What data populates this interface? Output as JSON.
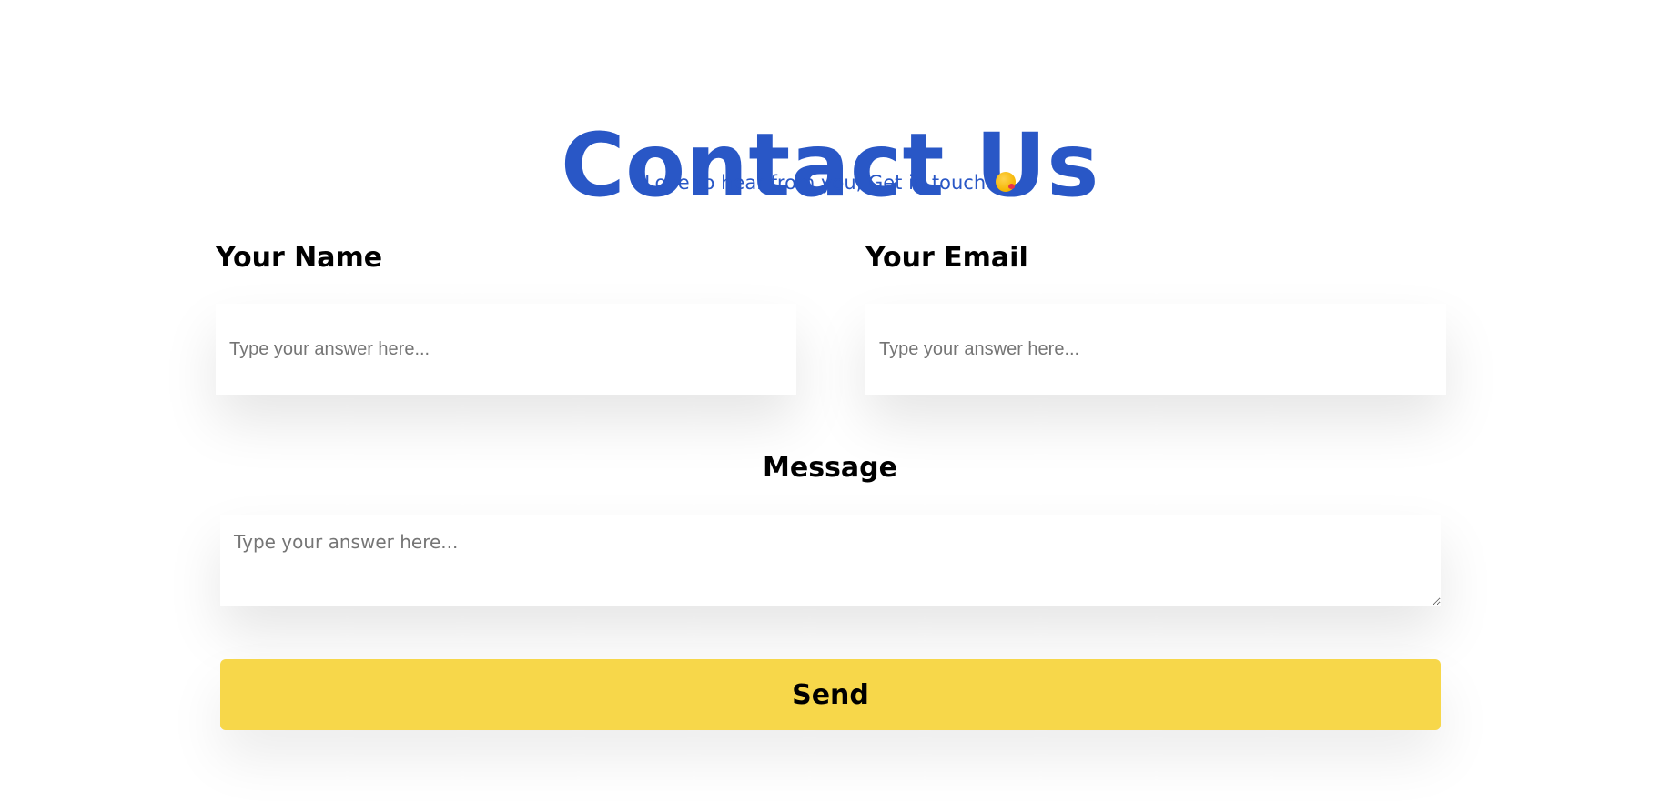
{
  "header": {
    "title": "Contact Us",
    "subtitle": "Love to hear from you, Get in touch",
    "subtitle_emoji": "face-blowing-kiss-icon"
  },
  "form": {
    "name": {
      "label": "Your Name",
      "placeholder": "Type your answer here...",
      "value": ""
    },
    "email": {
      "label": "Your Email",
      "placeholder": "Type your answer here...",
      "value": ""
    },
    "message": {
      "label": "Message",
      "placeholder": "Type your answer here...",
      "value": ""
    },
    "submit_label": "Send"
  },
  "colors": {
    "title": "#2957c6",
    "button": "#f7d74a",
    "text": "#000000",
    "placeholder": "#757575",
    "background": "#ffffff"
  }
}
